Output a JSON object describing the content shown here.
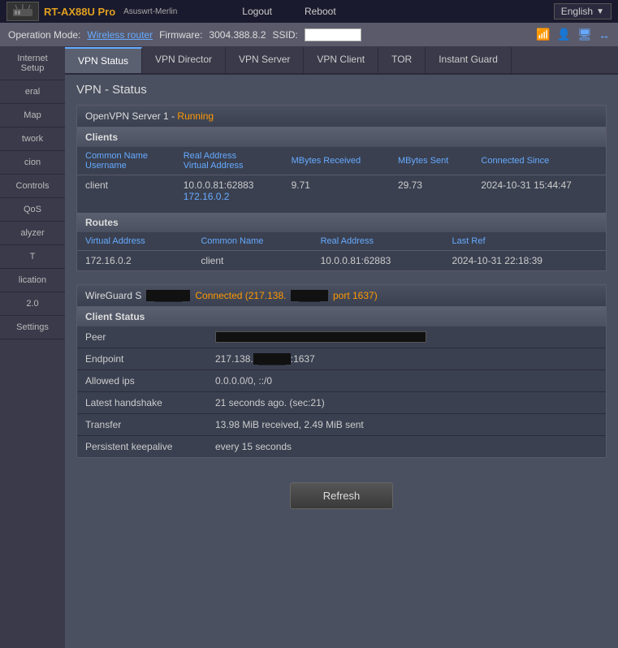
{
  "topbar": {
    "logo": "RT-AX88U Pro",
    "brand": "Asuswrt-Merlin",
    "nav": [
      "Logout",
      "Reboot"
    ],
    "language": "English"
  },
  "infobar": {
    "operation_mode_label": "Operation Mode:",
    "operation_mode_value": "Wireless router",
    "firmware_label": "Firmware:",
    "firmware_value": "3004.388.8.2",
    "ssid_label": "SSID:",
    "ssid_value": ""
  },
  "sidebar": {
    "items": [
      {
        "id": "internet-setup",
        "label": "Internet Setup"
      },
      {
        "id": "general",
        "label": "General"
      },
      {
        "id": "map",
        "label": "Map"
      },
      {
        "id": "network",
        "label": "Network"
      },
      {
        "id": "acion",
        "label": "cion"
      },
      {
        "id": "controls",
        "label": "Controls"
      },
      {
        "id": "qos",
        "label": "QoS"
      },
      {
        "id": "analyzer",
        "label": "nalyzer"
      },
      {
        "id": "t",
        "label": "T"
      },
      {
        "id": "lication",
        "label": "lication"
      },
      {
        "id": "2-0",
        "label": "2.0"
      },
      {
        "id": "settings",
        "label": "Settings"
      }
    ]
  },
  "tabs": [
    {
      "id": "vpn-status",
      "label": "VPN Status",
      "active": true
    },
    {
      "id": "vpn-director",
      "label": "VPN Director"
    },
    {
      "id": "vpn-server",
      "label": "VPN Server"
    },
    {
      "id": "vpn-client",
      "label": "VPN Client"
    },
    {
      "id": "tor",
      "label": "TOR"
    },
    {
      "id": "instant-guard",
      "label": "Instant Guard"
    }
  ],
  "page_title": "VPN - Status",
  "openvpn": {
    "header": "OpenVPN Server 1",
    "status": "Running",
    "clients_section": "Clients",
    "columns": {
      "common_name": "Common Name",
      "username": "Username",
      "real_address": "Real Address",
      "virtual_address": "Virtual Address",
      "mbytes_received": "MBytes Received",
      "mbytes_sent": "MBytes Sent",
      "connected_since": "Connected Since"
    },
    "clients": [
      {
        "common_name": "client",
        "real_address": "10.0.0.81:62883",
        "virtual_address": "172.16.0.2",
        "mbytes_received": "9.71",
        "mbytes_sent": "29.73",
        "connected_since": "2024-10-31 15:44:47"
      }
    ],
    "routes_section": "Routes",
    "route_columns": {
      "virtual_address": "Virtual Address",
      "common_name": "Common Name",
      "real_address": "Real Address",
      "last_ref": "Last Ref"
    },
    "routes": [
      {
        "virtual_address": "172.16.0.2",
        "common_name": "client",
        "real_address": "10.0.0.81:62883",
        "last_ref": "2024-10-31 22:18:39"
      }
    ]
  },
  "wireguard": {
    "header_prefix": "WireGuard S",
    "interface_redacted": "██████",
    "status_text": "Connected (217.138.",
    "ip_redacted": "█████",
    "port_text": "port 1637)",
    "client_status_section": "Client Status",
    "rows": [
      {
        "label": "Peer",
        "value": "",
        "type": "bar"
      },
      {
        "label": "Endpoint",
        "value": "217.138.",
        "redacted": "█████",
        "suffix": ":1637"
      },
      {
        "label": "Allowed ips",
        "value": "0.0.0.0/0, ::/0"
      },
      {
        "label": "Latest handshake",
        "value": "21 seconds ago. (sec:21)"
      },
      {
        "label": "Transfer",
        "value": "13.98 MiB received, 2.49 MiB sent"
      },
      {
        "label": "Persistent keepalive",
        "value": "every 15 seconds"
      }
    ]
  },
  "refresh_button": "Refresh"
}
